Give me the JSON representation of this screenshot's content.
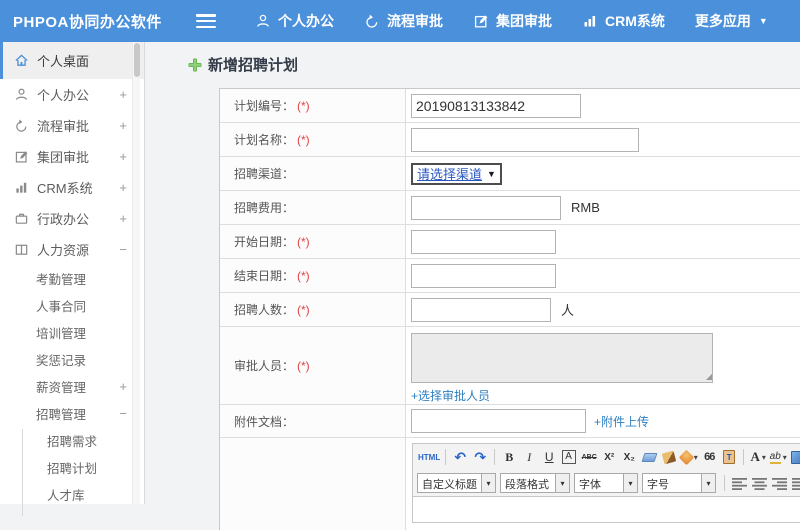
{
  "colors": {
    "header_blue": "#4a90db",
    "link_blue": "#2e7fc1",
    "required_red": "#e04343",
    "plus_green": "#5fb24b"
  },
  "header": {
    "logo": "PHPOA协同办公软件",
    "nav": [
      {
        "label": "个人办公"
      },
      {
        "label": "流程审批"
      },
      {
        "label": "集团审批"
      },
      {
        "label": "CRM系统"
      },
      {
        "label": "更多应用"
      }
    ],
    "more_caret": "▼"
  },
  "sidebar": {
    "items": [
      {
        "label": "个人桌面",
        "expander": ""
      },
      {
        "label": "个人办公",
        "expander": "+"
      },
      {
        "label": "流程审批",
        "expander": "+"
      },
      {
        "label": "集团审批",
        "expander": "+"
      },
      {
        "label": "CRM系统",
        "expander": "+"
      },
      {
        "label": "行政办公",
        "expander": "+"
      },
      {
        "label": "人力资源",
        "expander": "−"
      }
    ],
    "hr_children": [
      {
        "label": "考勤管理",
        "expander": ""
      },
      {
        "label": "人事合同",
        "expander": ""
      },
      {
        "label": "培训管理",
        "expander": ""
      },
      {
        "label": "奖惩记录",
        "expander": ""
      },
      {
        "label": "薪资管理",
        "expander": "+"
      },
      {
        "label": "招聘管理",
        "expander": "−"
      }
    ],
    "recruit_children": [
      {
        "label": "招聘需求"
      },
      {
        "label": "招聘计划"
      },
      {
        "label": "人才库"
      }
    ]
  },
  "main": {
    "title": "新增招聘计划",
    "form": {
      "plan_no": {
        "label": "计划编号：",
        "required": "(*)",
        "value": "20190813133842"
      },
      "plan_name": {
        "label": "计划名称：",
        "required": "(*)",
        "value": ""
      },
      "channel": {
        "label": "招聘渠道：",
        "select_value": "请选择渠道",
        "select_caret": "▼"
      },
      "fee": {
        "label": "招聘费用：",
        "value": "",
        "suffix": "RMB"
      },
      "start_date": {
        "label": "开始日期：",
        "required": "(*)",
        "value": ""
      },
      "end_date": {
        "label": "结束日期：",
        "required": "(*)",
        "value": ""
      },
      "headcount": {
        "label": "招聘人数：",
        "required": "(*)",
        "value": "",
        "suffix": "人"
      },
      "approvers": {
        "label": "审批人员：",
        "required": "(*)",
        "value": "",
        "link": "+选择审批人员"
      },
      "attachment": {
        "label": "附件文档：",
        "value": "",
        "link": "+附件上传"
      }
    },
    "editor": {
      "html_btn": "HTML",
      "undo": "↶",
      "redo": "↷",
      "bold": "B",
      "italic": "I",
      "underline": "U",
      "font_box": "A",
      "strike": "ABC",
      "superscript": "X²",
      "subscript": "X₂",
      "quote": "66",
      "paste_t": "T",
      "font_color": "A",
      "highlight": "ab",
      "selects": [
        {
          "label": "自定义标题"
        },
        {
          "label": "段落格式"
        },
        {
          "label": "字体"
        },
        {
          "label": "字号"
        }
      ]
    }
  }
}
